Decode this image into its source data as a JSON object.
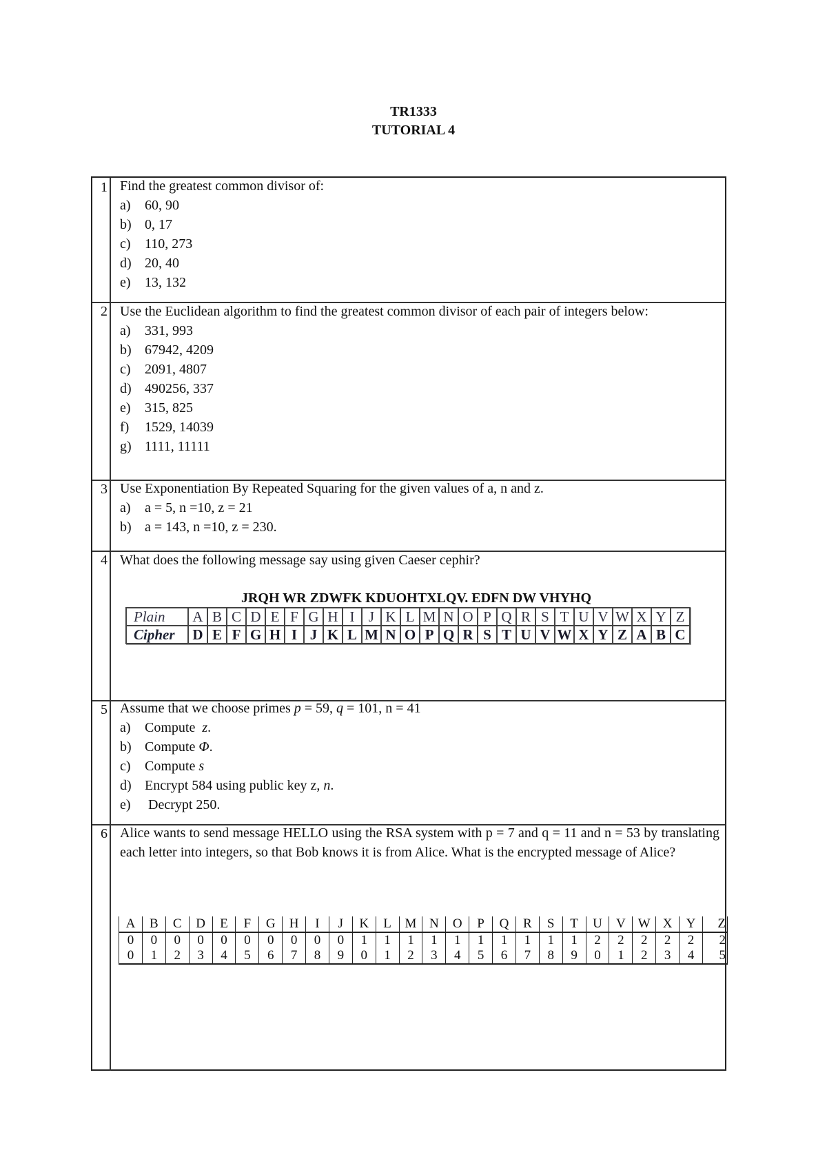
{
  "header": {
    "course_code": "TR1333",
    "title": "TUTORIAL 4"
  },
  "questions": [
    {
      "number": "1",
      "text": "Find the greatest common divisor of:",
      "items": [
        {
          "label": "a)",
          "text": "60, 90"
        },
        {
          "label": "b)",
          "text": "0, 17"
        },
        {
          "label": "c)",
          "text": "110, 273"
        },
        {
          "label": "d)",
          "text": "20, 40"
        },
        {
          "label": "e)",
          "text": "13, 132"
        }
      ]
    },
    {
      "number": "2",
      "text": "Use the Euclidean algorithm to find the greatest common divisor of each pair of integers below:",
      "items": [
        {
          "label": "a)",
          "text": "331, 993"
        },
        {
          "label": "b)",
          "text": "67942, 4209"
        },
        {
          "label": "c)",
          "text": "2091, 4807"
        },
        {
          "label": "d)",
          "text": "490256, 337"
        },
        {
          "label": "e)",
          "text": "315, 825"
        },
        {
          "label": "f)",
          "text": "1529, 14039"
        },
        {
          "label": "g)",
          "text": "1111, 11111"
        }
      ]
    },
    {
      "number": "3",
      "text": "Use Exponentiation By Repeated Squaring for the given values of a, n and z.",
      "items": [
        {
          "label": "a)",
          "text": "a = 5, n =10, z = 21"
        },
        {
          "label": "b)",
          "text": "a = 143, n =10, z = 230."
        }
      ]
    },
    {
      "number": "4",
      "text": "What does the following message say using given Caeser cephir?",
      "ciphertext": "JRQH WR ZDWFK KDUOHTXLQV. EDFN DW VHYHQ",
      "caesar_table": {
        "plain_label": "Plain",
        "cipher_label": "Cipher",
        "plain": [
          "A",
          "B",
          "C",
          "D",
          "E",
          "F",
          "G",
          "H",
          "I",
          "J",
          "K",
          "L",
          "M",
          "N",
          "O",
          "P",
          "Q",
          "R",
          "S",
          "T",
          "U",
          "V",
          "W",
          "X",
          "Y",
          "Z"
        ],
        "cipher": [
          "D",
          "E",
          "F",
          "G",
          "H",
          "I",
          "J",
          "K",
          "L",
          "M",
          "N",
          "O",
          "P",
          "Q",
          "R",
          "S",
          "T",
          "U",
          "V",
          "W",
          "X",
          "Y",
          "Z",
          "A",
          "B",
          "C"
        ]
      }
    },
    {
      "number": "5",
      "intro": "Assume that we choose primes ",
      "p_var": "p",
      "p_val": " = 59, ",
      "q_var": "q",
      "q_val": " = 101, n = 41",
      "items": [
        {
          "label": "a)",
          "pre": "Compute  ",
          "var": "z",
          "post": "."
        },
        {
          "label": "b)",
          "pre": "Compute ",
          "var": "Φ",
          "post": "."
        },
        {
          "label": "c)",
          "pre": "Compute ",
          "var": "s",
          "post": ""
        },
        {
          "label": "d)",
          "pre": "Encrypt 584 using public key z, ",
          "var": "n",
          "post": "."
        },
        {
          "label": "e)",
          "pre": " Decrypt 250.",
          "var": "",
          "post": ""
        }
      ]
    },
    {
      "number": "6",
      "text": "Alice wants to send message HELLO using the RSA system with p = 7 and q = 11 and n = 53 by translating each letter into integers, so that Bob knows it is from Alice. What is the encrypted message of Alice?",
      "letter_table": {
        "letters": [
          "A",
          "B",
          "C",
          "D",
          "E",
          "F",
          "G",
          "H",
          "I",
          "J",
          "K",
          "L",
          "M",
          "N",
          "O",
          "P",
          "Q",
          "R",
          "S",
          "T",
          "U",
          "V",
          "W",
          "X",
          "Y",
          "Z"
        ],
        "tens": [
          "0",
          "0",
          "0",
          "0",
          "0",
          "0",
          "0",
          "0",
          "0",
          "0",
          "1",
          "1",
          "1",
          "1",
          "1",
          "1",
          "1",
          "1",
          "1",
          "1",
          "2",
          "2",
          "2",
          "2",
          "2",
          "2"
        ],
        "ones": [
          "0",
          "1",
          "2",
          "3",
          "4",
          "5",
          "6",
          "7",
          "8",
          "9",
          "0",
          "1",
          "2",
          "3",
          "4",
          "5",
          "6",
          "7",
          "8",
          "9",
          "0",
          "1",
          "2",
          "3",
          "4",
          "5"
        ]
      }
    }
  ]
}
